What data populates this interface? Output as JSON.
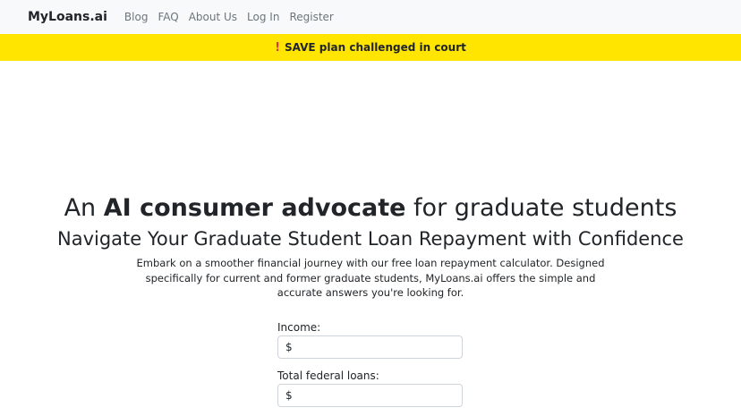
{
  "navbar": {
    "brand": "MyLoans.ai",
    "links": [
      "Blog",
      "FAQ",
      "About Us",
      "Log In",
      "Register"
    ]
  },
  "banner": {
    "icon": "exclamation-icon",
    "text": "SAVE plan challenged in court"
  },
  "hero": {
    "headline_pre": "An ",
    "headline_bold": "AI consumer advocate",
    "headline_post": " for graduate students",
    "subheadline": "Navigate Your Graduate Student Loan Repayment with Confidence",
    "intro": "Embark on a smoother financial journey with our free loan repayment calculator. Designed specifically for current and former graduate students, MyLoans.ai offers the simple and accurate answers you're looking for."
  },
  "form": {
    "income_label": "Income:",
    "income_prefix": "$",
    "loans_label": "Total federal loans:",
    "loans_prefix": "$"
  }
}
